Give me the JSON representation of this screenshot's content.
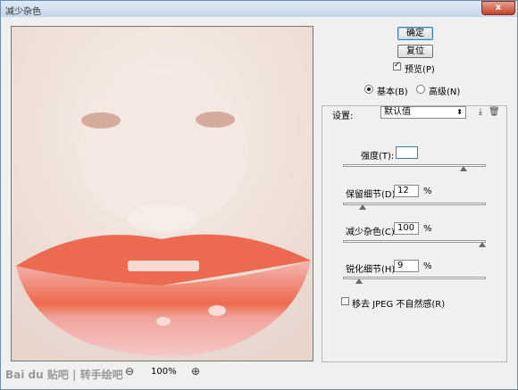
{
  "window": {
    "title": "减少杂色",
    "close_label": "x"
  },
  "preview": {
    "zoom_out": "⊖",
    "zoom_level": "100%",
    "zoom_in": "⊕"
  },
  "watermark": "Bai du 贴吧 | 转手绘吧",
  "buttons": {
    "ok": "确定",
    "reset": "复位"
  },
  "preview_toggle": {
    "label": "预览(P)",
    "checked": true
  },
  "mode": {
    "basic": "基本(B)",
    "advanced": "高级(N)",
    "selected": "basic"
  },
  "settings": {
    "label": "设置:",
    "value": "默认值"
  },
  "sliders": [
    {
      "label": "强度(T):",
      "value": "",
      "unit": "",
      "level": 0.86
    },
    {
      "label": "保留细节(D):",
      "value": "12",
      "unit": "%",
      "level": 0.12
    },
    {
      "label": "减少杂色(C):",
      "value": "100",
      "unit": "%",
      "level": 1.0
    },
    {
      "label": "锐化细节(H):",
      "value": "9",
      "unit": "%",
      "level": 0.09
    }
  ],
  "jpeg": {
    "label": "移去 JPEG 不自然感(R)",
    "checked": false
  }
}
